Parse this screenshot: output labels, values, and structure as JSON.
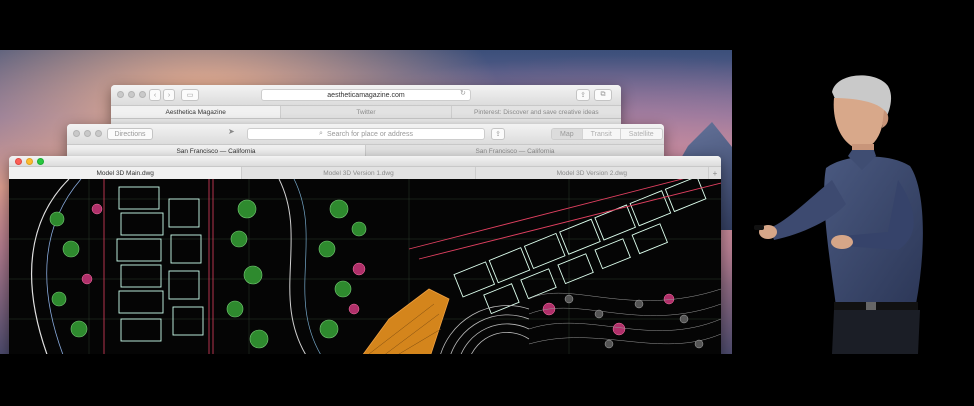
{
  "back_window": {
    "address": "aestheticamagazine.com",
    "tabs": [
      "Aesthetica Magazine",
      "Twitter",
      "Pinterest: Discover and save creative ideas"
    ]
  },
  "maps_window": {
    "directions_label": "Directions",
    "search_placeholder": "Search for place or address",
    "view_modes": [
      "Map",
      "Transit",
      "Satellite"
    ],
    "tabs": [
      "San Francisco — California",
      "San Francisco — California"
    ]
  },
  "cad_window": {
    "tabs": [
      "Model 3D Main.dwg",
      "Model 3D Version 1.dwg",
      "Model 3D Version 2.dwg"
    ],
    "add_tab_glyph": "+"
  },
  "icons": {
    "back_window": [
      "chevron-left-icon",
      "chevron-right-icon",
      "sidebar-icon",
      "reload-icon",
      "share-icon",
      "new-tab-icon"
    ],
    "maps_window": [
      "location-arrow-icon",
      "search-icon",
      "share-icon"
    ]
  },
  "colors": {
    "close": "#fc5f57",
    "minimize": "#fdbc2e",
    "zoom": "#28c840",
    "cad_background": "#050505"
  }
}
